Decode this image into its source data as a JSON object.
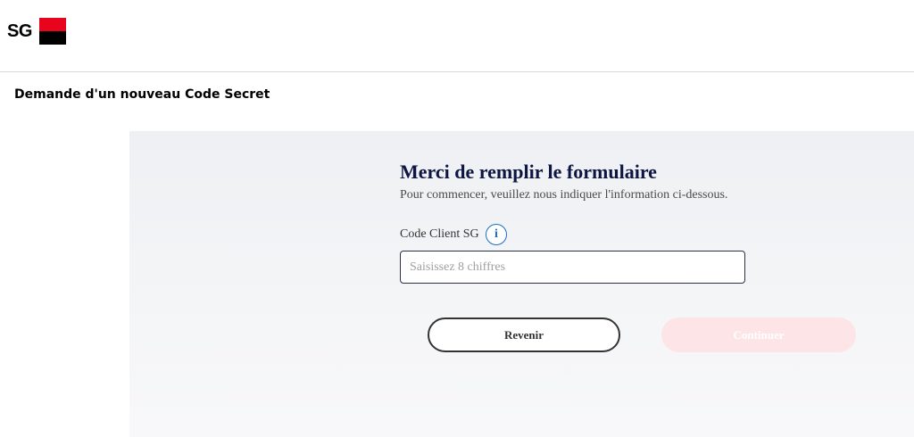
{
  "header": {
    "logo_text": "SG",
    "logo_colors": {
      "top": "#e9041e",
      "bottom": "#000000"
    }
  },
  "page": {
    "title": "Demande d'un nouveau Code Secret"
  },
  "form": {
    "title": "Merci de remplir le formulaire",
    "subtitle": "Pour commencer, veuillez nous indiquer l'information ci-dessous.",
    "field": {
      "label": "Code Client SG",
      "info_icon": "info-icon",
      "info_glyph": "i",
      "value": "",
      "placeholder": "Saisissez 8 chiffres"
    },
    "buttons": {
      "back_label": "Revenir",
      "continue_label": "Continuer",
      "continue_enabled": false
    }
  },
  "colors": {
    "title_navy": "#0d1642",
    "info_blue": "#1b6ec2",
    "continue_disabled_bg": "#fde4e6"
  }
}
